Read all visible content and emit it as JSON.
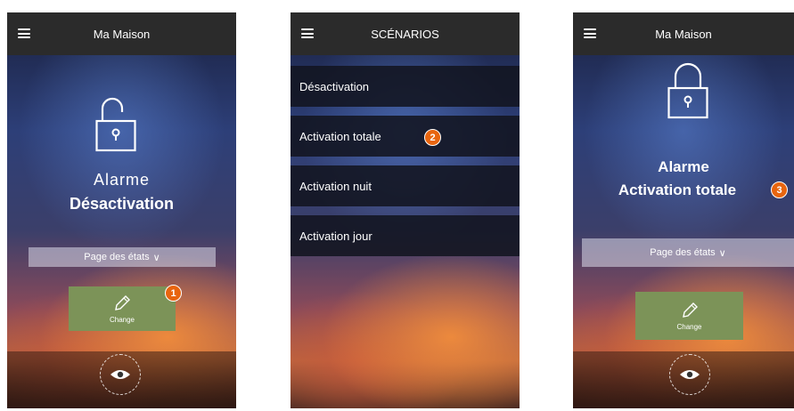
{
  "screens": [
    {
      "header": {
        "title": "Ma Maison"
      },
      "alarm": {
        "label": "Alarme",
        "state": "Désactivation"
      },
      "states_page": {
        "label": "Page des états",
        "chevron": "chevron-down-icon"
      },
      "change_button": {
        "label": "Change"
      },
      "badge": "1"
    },
    {
      "header": {
        "title": "SCÉNARIOS"
      },
      "scenarios": [
        {
          "label": "Désactivation"
        },
        {
          "label": "Activation totale"
        },
        {
          "label": "Activation nuit"
        },
        {
          "label": "Activation jour"
        }
      ],
      "badge": "2"
    },
    {
      "header": {
        "title": "Ma Maison"
      },
      "alarm": {
        "label": "Alarme",
        "state": "Activation totale"
      },
      "states_page": {
        "label": "Page des états",
        "chevron": "chevron-down-icon"
      },
      "change_button": {
        "label": "Change"
      },
      "badge": "3"
    }
  ],
  "colors": {
    "topbar": "#2b2b2b",
    "change_button": "#7c9358",
    "badge": "#e8650f"
  }
}
